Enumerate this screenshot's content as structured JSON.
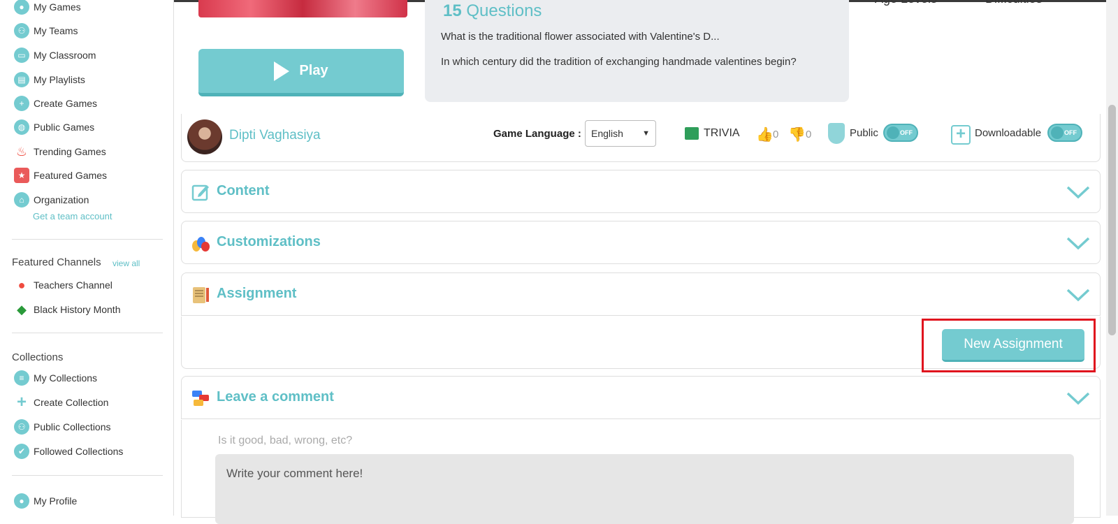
{
  "sidebar": {
    "nav": [
      {
        "label": "My Games",
        "icon": "user-circle-icon"
      },
      {
        "label": "My Teams",
        "icon": "team-icon"
      },
      {
        "label": "My Classroom",
        "icon": "classroom-icon"
      },
      {
        "label": "My Playlists",
        "icon": "playlist-icon"
      },
      {
        "label": "Create Games",
        "icon": "plus-circle-icon"
      },
      {
        "label": "Public Games",
        "icon": "globe-icon"
      },
      {
        "label": "Trending Games",
        "icon": "flame-icon"
      },
      {
        "label": "Featured Games",
        "icon": "star-icon"
      },
      {
        "label": "Organization",
        "icon": "organization-icon"
      }
    ],
    "team_link": "Get a team account",
    "featured_heading": "Featured Channels",
    "view_all": "view all",
    "channels": [
      {
        "label": "Teachers Channel",
        "icon": "apple-icon"
      },
      {
        "label": "Black History Month",
        "icon": "africa-icon"
      }
    ],
    "collections_heading": "Collections",
    "collections": [
      {
        "label": "My Collections",
        "icon": "list-icon"
      },
      {
        "label": "Create Collection",
        "icon": "plus-icon"
      },
      {
        "label": "Public Collections",
        "icon": "people-icon"
      },
      {
        "label": "Followed Collections",
        "icon": "check-circle-icon"
      }
    ],
    "profile": "My Profile"
  },
  "game": {
    "play_label": "Play",
    "question_count": "15",
    "questions_word": "Questions",
    "questions": [
      "What is the traditional flower associated with Valentine's D...",
      "In which century did the tradition of exchanging handmade valentines begin?"
    ],
    "age_levels": "Age Levels",
    "difficulties": "Difficulties"
  },
  "author": {
    "name": "Dipti Vaghasiya",
    "language_label": "Game Language :",
    "language_value": "English",
    "type": "TRIVIA",
    "likes": "0",
    "dislikes": "0",
    "public_label": "Public",
    "public_toggle": "OFF",
    "download_label": "Downloadable",
    "download_toggle": "OFF"
  },
  "panels": {
    "content": "Content",
    "customizations": "Customizations",
    "assignment": "Assignment",
    "comment": "Leave a comment"
  },
  "assignment": {
    "new_button": "New Assignment"
  },
  "comment": {
    "hint": "Is it good, bad, wrong, etc?",
    "placeholder": "Write your comment here!"
  },
  "colors": {
    "accent": "#74cbd0",
    "highlight": "#e0141e"
  }
}
